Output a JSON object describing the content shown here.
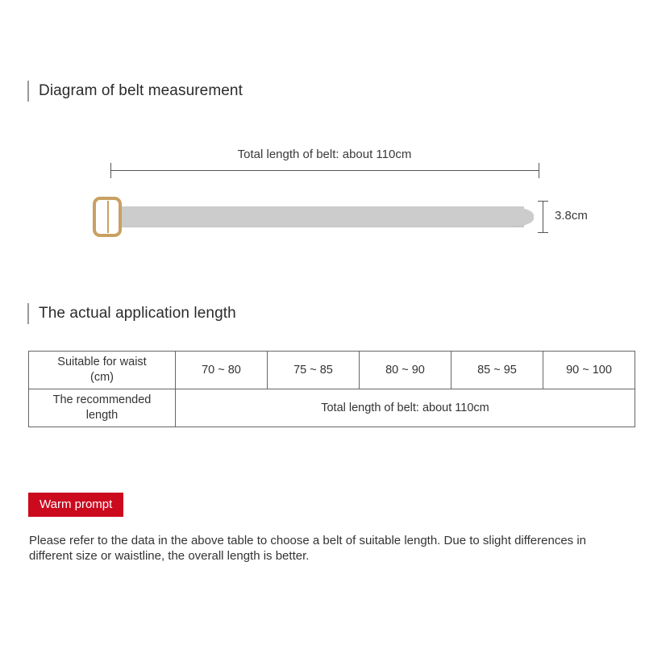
{
  "sections": {
    "diagram": {
      "heading": "Diagram of belt measurement",
      "total_length_label": "Total length of belt: about 110cm",
      "width_label": "3.8cm",
      "buckle_icon": "belt-buckle-icon",
      "strap_color": "#cccccc",
      "buckle_color": "#c9a063",
      "dimension_line_color": "#555555"
    },
    "application": {
      "heading": "The actual application length"
    }
  },
  "table": {
    "rows": [
      {
        "label": "Suitable for waist\n(cm)",
        "label_line1": "Suitable for waist",
        "label_line2": "(cm)",
        "values": [
          "70 ~ 80",
          "75 ~ 85",
          "80 ~ 90",
          "85 ~ 95",
          "90 ~ 100"
        ]
      },
      {
        "label_line1": "The recommended",
        "label_line2": "length",
        "merged_value": "Total length of belt: about 110cm"
      }
    ]
  },
  "warm_prompt": {
    "badge_label": "Warm prompt",
    "badge_color": "#cc0a1e",
    "text": "Please refer to the data in the above table to choose a belt of suitable length. Due to slight differences in different size or waistline, the overall length is better."
  }
}
